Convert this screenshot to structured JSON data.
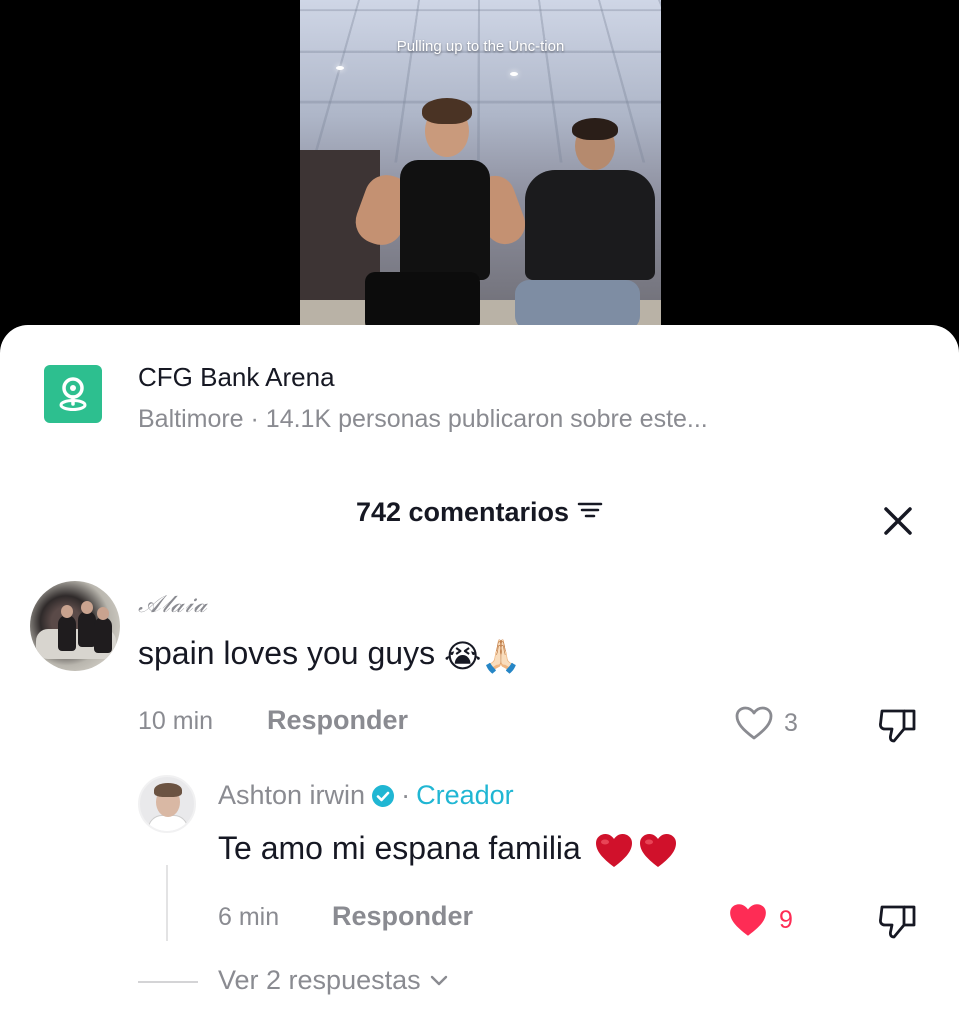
{
  "video": {
    "caption": "Pulling up to the Unc-tion"
  },
  "location": {
    "icon": "location-pin-icon",
    "title": "CFG Bank Arena",
    "subtitle": "Baltimore · 14.1K personas publicaron sobre este..."
  },
  "comments": {
    "count_label": "742 comentarios",
    "sort_icon": "sort-filter-icon",
    "close_icon": "close-icon",
    "items": [
      {
        "author": "𝒜𝓁𝒶𝒾𝒶",
        "text": "spain loves you guys",
        "emojis": "😭🙏🏻",
        "time": "10 min",
        "reply_label": "Responder",
        "likes": "3",
        "liked": false,
        "replies": [
          {
            "author": "Ashton irwin",
            "verified": true,
            "separator": "·",
            "badge": "Creador",
            "text": "Te amo mi espana familia",
            "emojis": "❤️❤️",
            "time": "6 min",
            "reply_label": "Responder",
            "likes": "9",
            "liked": true
          }
        ],
        "view_more_label": "Ver 2 respuestas"
      }
    ]
  },
  "colors": {
    "accent_red": "#fe2c55",
    "creator_blue": "#20b6d3",
    "location_green": "#2dbf8f",
    "text_primary": "#161823",
    "text_secondary": "#8a8b91"
  }
}
